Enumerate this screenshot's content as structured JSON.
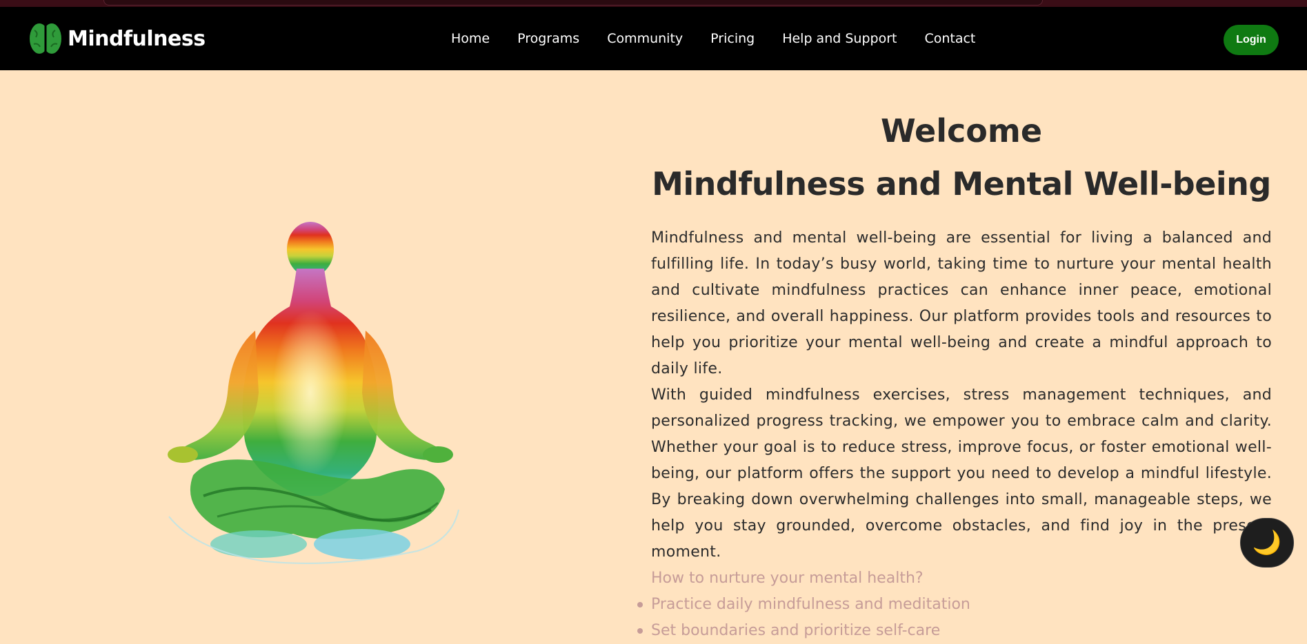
{
  "brand": {
    "name": "Mindfulness",
    "logo_icon": "brain-icon",
    "logo_color": "#2f9b3a"
  },
  "nav": {
    "items": [
      {
        "label": "Home"
      },
      {
        "label": "Programs"
      },
      {
        "label": "Community"
      },
      {
        "label": "Pricing"
      },
      {
        "label": "Help and Support"
      },
      {
        "label": "Contact"
      }
    ],
    "login_label": "Login",
    "login_color": "#0f7a12"
  },
  "hero": {
    "illustration_icon": "meditation-figure-icon",
    "welcome": "Welcome",
    "headline": "Mindfulness and Mental Well-being",
    "paragraph1": "Mindfulness and mental well-being are essential for living a balanced and fulfilling life. In today’s busy world, taking time to nurture your mental health and cultivate mindfulness practices can enhance inner peace, emotional resilience, and overall happiness. Our platform provides tools and resources to help you prioritize your mental well-being and create a mindful approach to daily life.",
    "paragraph2": "With guided mindfulness exercises, stress management techniques, and personalized progress tracking, we empower you to embrace calm and clarity. Whether your goal is to reduce stress, improve focus, or foster emotional well-being, our platform offers the support you need to develop a mindful lifestyle. By breaking down overwhelming challenges into small, manageable steps, we help you stay grounded, overcome obstacles, and find joy in the present moment.",
    "subheading": "How to nurture your mental health?",
    "tips": [
      "Practice daily mindfulness and meditation",
      "Set boundaries and prioritize self-care"
    ]
  },
  "theme_toggle": {
    "icon": "moon-icon",
    "glyph": "🌙"
  },
  "colors": {
    "background": "#FFE3C0",
    "header": "#000000",
    "text": "#2b2b2b",
    "muted_accent": "#c69c98"
  }
}
